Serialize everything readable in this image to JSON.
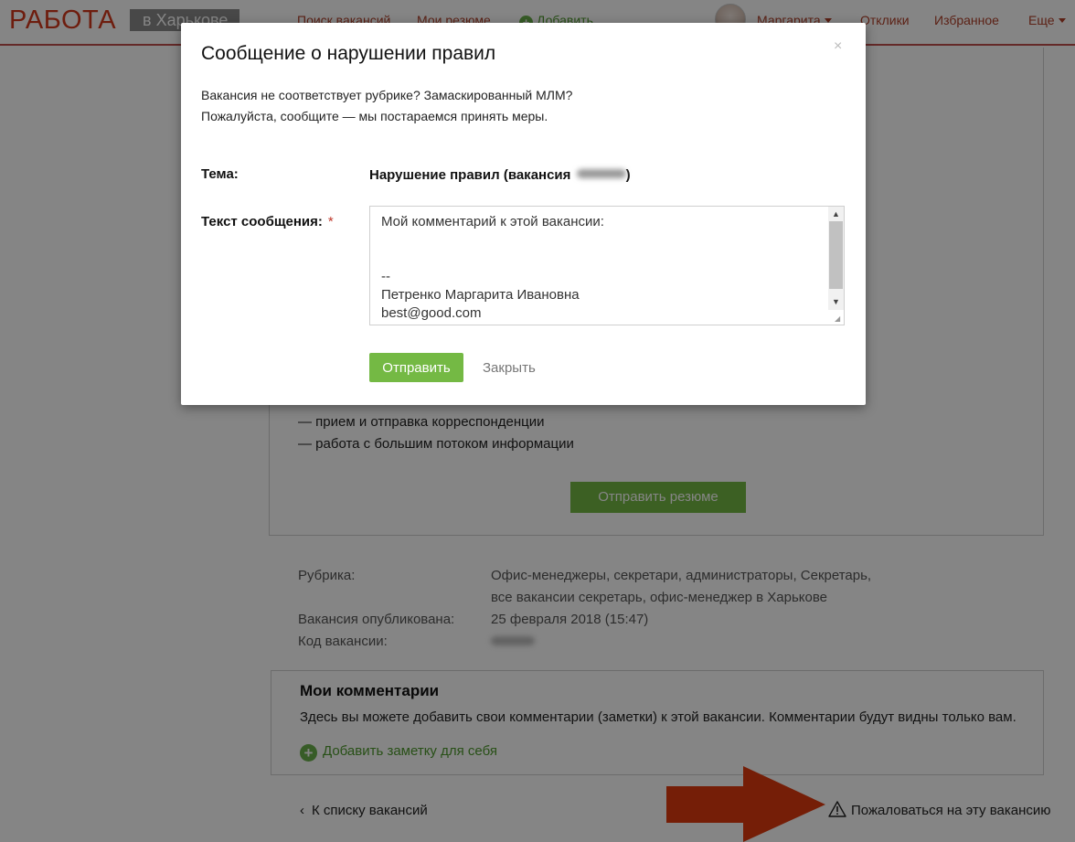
{
  "header": {
    "logo": "РАБОТА",
    "city": "в Харькове",
    "nav": {
      "search": "Поиск вакансий",
      "resumes": "Мои резюме",
      "add": "Добавить",
      "user": "Маргарита",
      "responses": "Отклики",
      "favorites": "Избранное",
      "more": "Еще"
    }
  },
  "vacancy": {
    "duties": [
      "— прием и отправка корреспонденции",
      "— работа с большим потоком информации"
    ],
    "send_resume": "Отправить резюме"
  },
  "meta": {
    "rubric_label": "Рубрика:",
    "rubric_value_line1": "Офис-менеджеры, секретари, администраторы,  Секретарь,",
    "rubric_value_line2": "все вакансии секретарь, офис-менеджер в Харькове",
    "published_label": "Вакансия опубликована:",
    "published_value": "25 февраля 2018 (15:47)",
    "code_label": "Код вакансии:"
  },
  "comments": {
    "title": "Мои комментарии",
    "description": "Здесь вы можете добавить свои комментарии (заметки) к этой вакансии. Комментарии будут видны только вам.",
    "add_note": "Добавить заметку для себя"
  },
  "footer": {
    "back": "К списку вакансий",
    "complain": "Пожаловаться на эту вакансию"
  },
  "modal": {
    "title": "Сообщение о нарушении правил",
    "close_icon": "×",
    "intro_line1": "Вакансия не соответствует рубрике? Замаскированный МЛМ?",
    "intro_line2": "Пожалуйста, сообщите — мы постараемся принять меры.",
    "subject_label": "Тема:",
    "subject_value_prefix": "Нарушение правил (вакансия ",
    "subject_value_suffix": ")",
    "message_label": "Текст сообщения:",
    "required": "*",
    "message_value": "Мой комментарий к этой вакансии:\n\n\n--\nПетренко Маргарита Ивановна\nbest@good.com",
    "submit": "Отправить",
    "close": "Закрыть"
  },
  "colors": {
    "brand": "#d4381c",
    "accent_green": "#74b944",
    "arrow": "#e03a0e"
  }
}
